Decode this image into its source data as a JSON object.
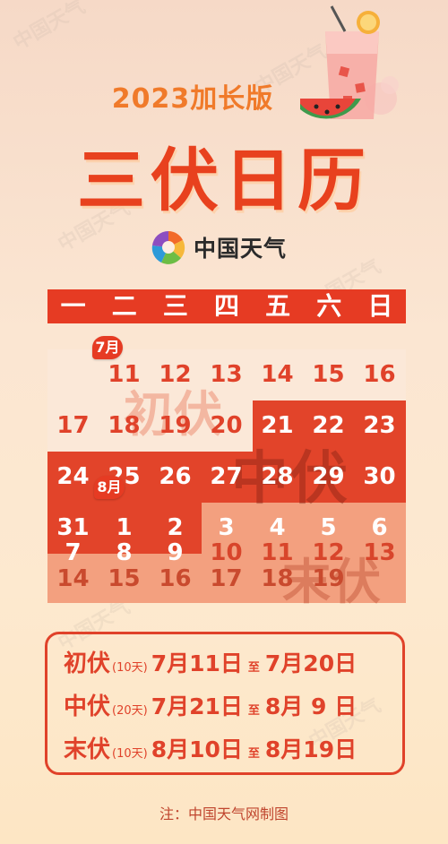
{
  "header": {
    "year_label": "2023加长版",
    "title": "三伏日历"
  },
  "brand": {
    "name": "中国天气"
  },
  "weekdays": [
    "一",
    "二",
    "三",
    "四",
    "五",
    "六",
    "日"
  ],
  "month_tags": {
    "july": "7月",
    "august": "8月"
  },
  "calendar": {
    "row1": [
      "11",
      "12",
      "13",
      "14",
      "15",
      "16"
    ],
    "row2": [
      "17",
      "18",
      "19",
      "20",
      "21",
      "22",
      "23"
    ],
    "row3": [
      "24",
      "25",
      "26",
      "27",
      "28",
      "29",
      "30"
    ],
    "row4": [
      "31",
      "1",
      "2",
      "3",
      "4",
      "5",
      "6"
    ],
    "row5": [
      "7",
      "8",
      "9",
      "10",
      "11",
      "12",
      "13"
    ],
    "row6": [
      "14",
      "15",
      "16",
      "17",
      "18",
      "19"
    ]
  },
  "periods": {
    "chufu": {
      "label": "初伏",
      "days": "(10天)",
      "start": "7月11日",
      "to": "至",
      "end": "7月20日"
    },
    "zhongfu": {
      "label": "中伏",
      "days": "(20天)",
      "start": "7月21日",
      "to": "至",
      "end": "8月 9 日"
    },
    "mofu": {
      "label": "末伏",
      "days": "(10天)",
      "start": "8月10日",
      "to": "至",
      "end": "8月19日"
    }
  },
  "footer": {
    "note": "注：中国天气网制图"
  },
  "colors": {
    "accent": "#e63b23",
    "chufu_bg": "#fbe8d8",
    "zhongfu_bg": "#e2442a",
    "mofu_bg": "#f3a07f"
  },
  "watermark": "中国天气"
}
